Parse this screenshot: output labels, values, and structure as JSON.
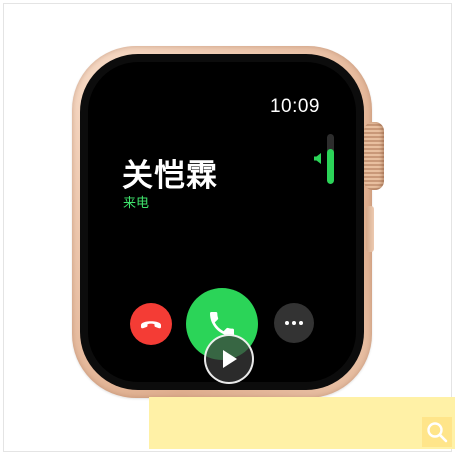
{
  "watch": {
    "time": "10:09",
    "caller_name": "关恺霖",
    "call_status": "来电",
    "volume_level": 0.7
  },
  "icons": {
    "decline": "phone-hangup-icon",
    "answer": "phone-icon",
    "more": "ellipsis-icon",
    "play": "play-icon",
    "search": "search-icon",
    "speaker": "speaker-icon"
  },
  "colors": {
    "decline": "#f43c35",
    "answer": "#2bd458",
    "status": "#3fe36c",
    "case": "#edc7ad",
    "panel": "#fff1a6"
  }
}
